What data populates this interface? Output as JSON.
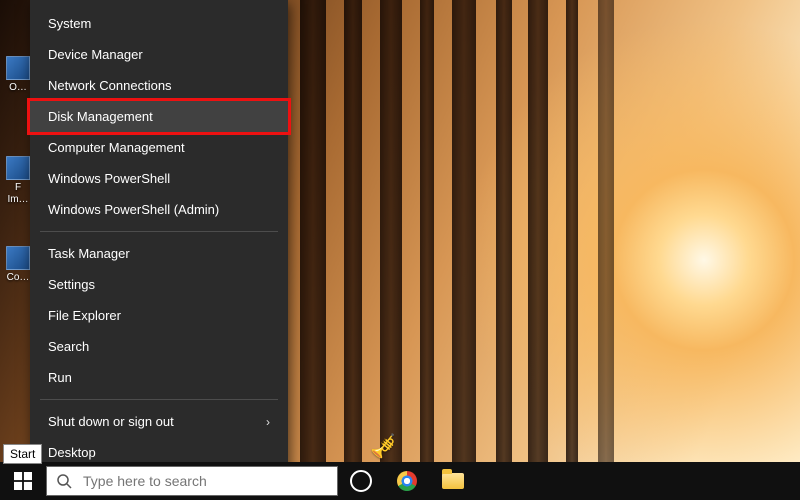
{
  "desktop_icons": [
    {
      "label": "O…"
    },
    {
      "label": "F Im…"
    },
    {
      "label": "Co…"
    }
  ],
  "winx_menu": {
    "groups": [
      {
        "items": [
          {
            "id": "system",
            "label": "System"
          },
          {
            "id": "device-manager",
            "label": "Device Manager"
          },
          {
            "id": "network-connections",
            "label": "Network Connections"
          },
          {
            "id": "disk-management",
            "label": "Disk Management",
            "highlighted": true,
            "hovered": true
          },
          {
            "id": "computer-management",
            "label": "Computer Management"
          },
          {
            "id": "windows-powershell",
            "label": "Windows PowerShell"
          },
          {
            "id": "windows-powershell-admin",
            "label": "Windows PowerShell (Admin)"
          }
        ]
      },
      {
        "items": [
          {
            "id": "task-manager",
            "label": "Task Manager"
          },
          {
            "id": "settings",
            "label": "Settings"
          },
          {
            "id": "file-explorer",
            "label": "File Explorer"
          },
          {
            "id": "search",
            "label": "Search"
          },
          {
            "id": "run",
            "label": "Run"
          }
        ]
      },
      {
        "items": [
          {
            "id": "shut-down-or-sign-out",
            "label": "Shut down or sign out",
            "submenu": true
          },
          {
            "id": "desktop",
            "label": "Desktop"
          }
        ]
      }
    ]
  },
  "tooltip": {
    "start": "Start"
  },
  "taskbar": {
    "search_placeholder": "Type here to search",
    "items": [
      {
        "id": "start",
        "name": "start-button"
      },
      {
        "id": "search",
        "name": "search-box"
      },
      {
        "id": "task-view",
        "name": "task-view-button"
      },
      {
        "id": "chrome",
        "name": "chrome-taskbar-button"
      },
      {
        "id": "explorer",
        "name": "file-explorer-taskbar-button"
      }
    ]
  },
  "colors": {
    "menu_bg": "#2b2b2b",
    "menu_hover": "#414141",
    "highlight": "#ee1111",
    "taskbar": "#101010"
  }
}
